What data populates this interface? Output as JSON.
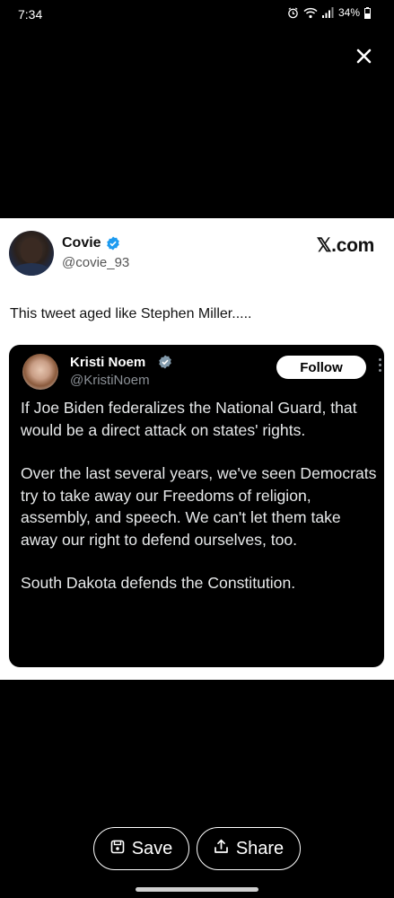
{
  "status_bar": {
    "time": "7:34",
    "battery": "34%"
  },
  "post": {
    "author_name": "Covie",
    "author_handle": "@covie_93",
    "site_logo": "𝕏.com",
    "text": "This tweet aged like Stephen Miller.....",
    "quoted": {
      "name": "Kristi Noem",
      "handle": "@KristiNoem",
      "follow_label": "Follow",
      "paragraphs": [
        "If Joe Biden federalizes the National Guard, that would be a direct attack on states' rights.",
        "Over the last several years, we've seen Democrats try to take away our Freedoms of religion, assembly, and speech. We can't let them take away our right to defend ourselves, too.",
        "South Dakota defends the Constitution."
      ]
    }
  },
  "actions": {
    "save_label": "Save",
    "share_label": "Share"
  },
  "colors": {
    "verified_blue": "#1d9bf0",
    "verified_gray": "#829aab",
    "background": "#000000"
  }
}
